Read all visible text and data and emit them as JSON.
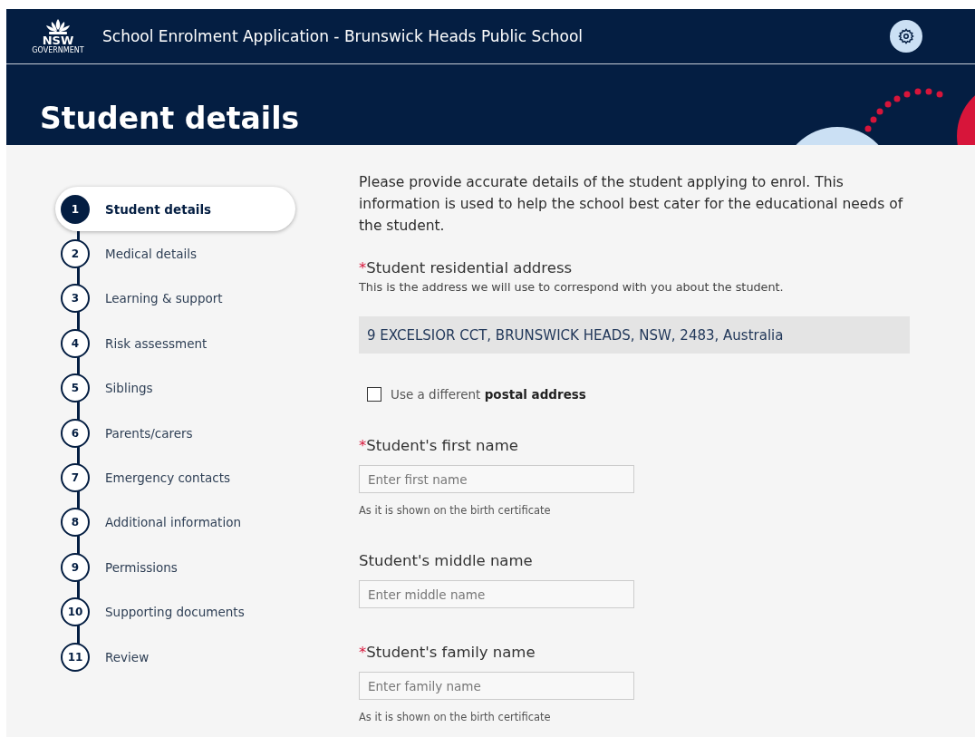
{
  "header": {
    "logo": {
      "text": "NSW",
      "subtext": "GOVERNMENT"
    },
    "title": "School Enrolment Application - Brunswick Heads Public School"
  },
  "page_title": "Student details",
  "steps": [
    {
      "number": "1",
      "label": "Student details",
      "selected": true
    },
    {
      "number": "2",
      "label": "Medical details",
      "selected": false
    },
    {
      "number": "3",
      "label": "Learning & support",
      "selected": false
    },
    {
      "number": "4",
      "label": "Risk assessment",
      "selected": false
    },
    {
      "number": "5",
      "label": "Siblings",
      "selected": false
    },
    {
      "number": "6",
      "label": "Parents/carers",
      "selected": false
    },
    {
      "number": "7",
      "label": "Emergency contacts",
      "selected": false
    },
    {
      "number": "8",
      "label": "Additional information",
      "selected": false
    },
    {
      "number": "9",
      "label": "Permissions",
      "selected": false
    },
    {
      "number": "10",
      "label": "Supporting documents",
      "selected": false
    },
    {
      "number": "11",
      "label": "Review",
      "selected": false
    }
  ],
  "intro": "Please provide accurate details of the student applying to enrol. This information is used to help the school best cater for the educational needs of the student.",
  "fields": [
    {
      "kind": "address",
      "required_mark": "*",
      "label": "Student residential address",
      "hint": "This is the address we will use to correspond with you about the student.",
      "value": "9 EXCELSIOR CCT, BRUNSWICK HEADS, NSW, 2483, Australia"
    },
    {
      "kind": "checkbox",
      "label": "Use a different **postal address**",
      "checked": false
    },
    {
      "kind": "text",
      "required_mark": "*",
      "label": "Student's first name",
      "placeholder": "Enter first name",
      "helper": "As it is shown on the birth certificate"
    },
    {
      "kind": "text",
      "label": "Student's middle name",
      "placeholder": "Enter middle name"
    },
    {
      "kind": "text",
      "required_mark": "*",
      "label": "Student's family name",
      "placeholder": "Enter family name",
      "helper": "As it is shown on the birth certificate"
    }
  ]
}
